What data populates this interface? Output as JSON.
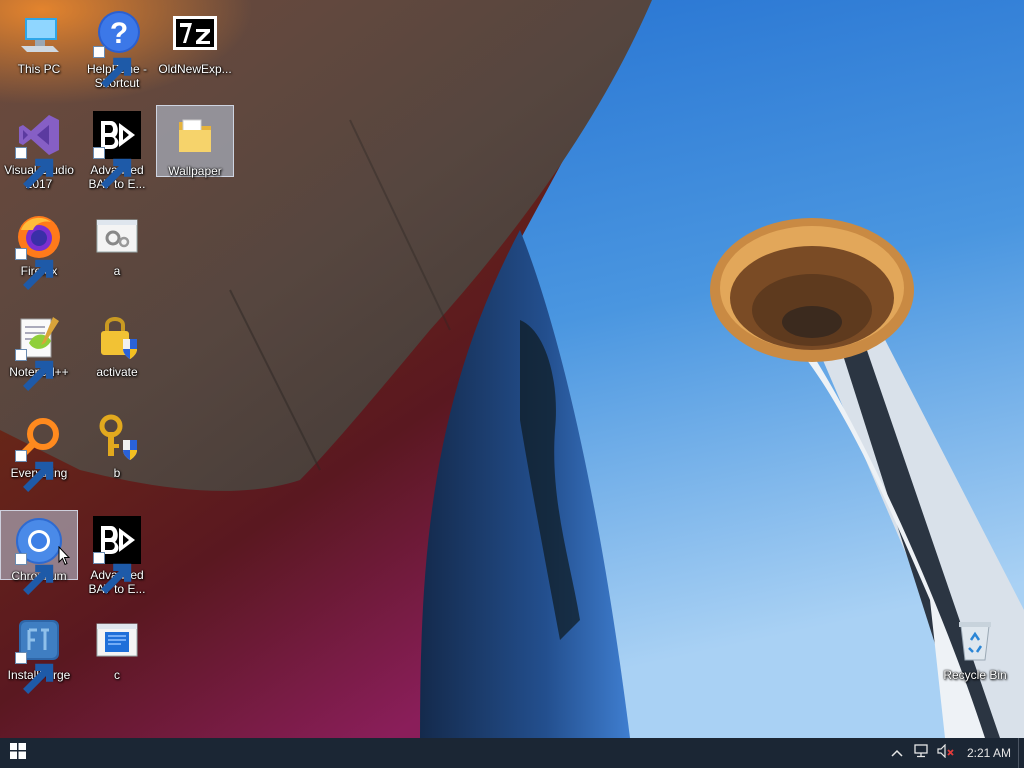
{
  "desktop": {
    "icons": [
      {
        "label": "This PC",
        "icon": "computer-icon",
        "shortcut": false
      },
      {
        "label": "HelpPane - Shortcut",
        "icon": "help-icon",
        "shortcut": true
      },
      {
        "label": "OldNewExp...",
        "icon": "7zip-icon",
        "shortcut": false
      },
      {
        "label": "Visual Studio 2017",
        "icon": "visual-studio-icon",
        "shortcut": true
      },
      {
        "label": "Advanced BAT to E...",
        "icon": "bat-to-exe-icon",
        "shortcut": true
      },
      {
        "label": "Wallpaper",
        "icon": "folder-icon",
        "shortcut": false,
        "selected": true
      },
      {
        "label": "Firefox",
        "icon": "firefox-icon",
        "shortcut": true
      },
      {
        "label": "a",
        "icon": "settings-file-icon",
        "shortcut": false
      },
      {
        "label": "Notepad++",
        "icon": "notepad-plus-plus-icon",
        "shortcut": true
      },
      {
        "label": "activate",
        "icon": "lock-shield-icon",
        "shortcut": false
      },
      {
        "label": "Everything",
        "icon": "search-magnifier-icon",
        "shortcut": true
      },
      {
        "label": "b",
        "icon": "key-shield-icon",
        "shortcut": false
      },
      {
        "label": "Chromium",
        "icon": "chromium-icon",
        "shortcut": true,
        "selected": true
      },
      {
        "label": "Advanced BAT to E...",
        "icon": "bat-to-exe-icon",
        "shortcut": true
      },
      {
        "label": "InstallForge",
        "icon": "installforge-icon",
        "shortcut": true
      },
      {
        "label": "c",
        "icon": "window-document-icon",
        "shortcut": false
      },
      {
        "label": "Recycle Bin",
        "icon": "recycle-bin-icon",
        "shortcut": false
      }
    ]
  },
  "taskbar": {
    "start_icon": "windows-logo-icon",
    "tray": {
      "overflow_icon": "chevron-up-icon",
      "network_icon": "network-icon",
      "volume_icon": "volume-muted-icon",
      "clock": "2:21 AM"
    }
  },
  "colors": {
    "taskbar": "#1b2634",
    "sky": "#2f7fd6",
    "selection": "#bccde1"
  }
}
